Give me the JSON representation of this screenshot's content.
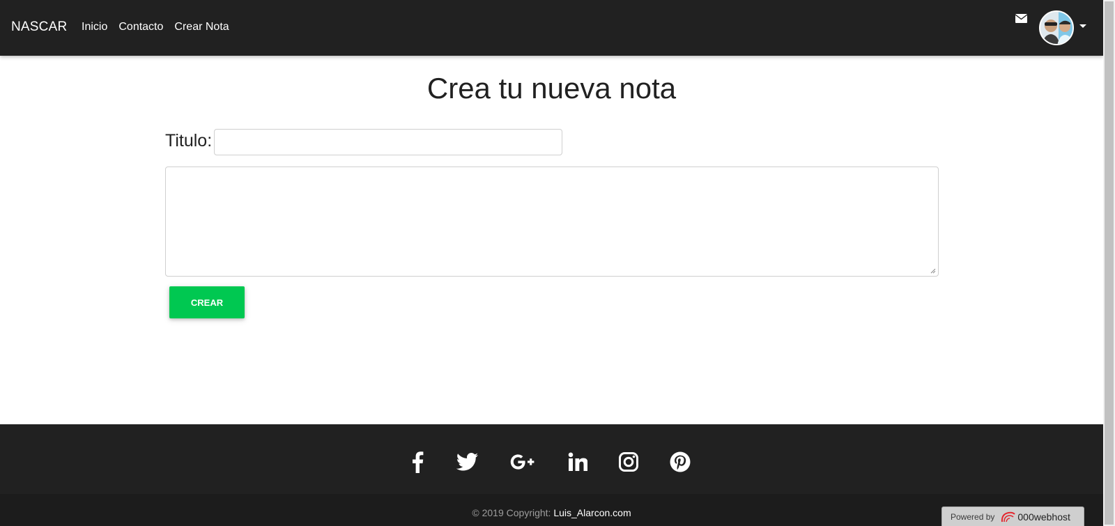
{
  "navbar": {
    "brand": "NASCAR",
    "links": [
      {
        "label": "Inicio"
      },
      {
        "label": "Contacto"
      },
      {
        "label": "Crear Nota"
      }
    ],
    "mail_icon": "envelope-icon",
    "avatar_icon": "user-avatar",
    "dropdown_icon": "caret-down-icon"
  },
  "main": {
    "title": "Crea tu nueva nota",
    "titulo_label": "Titulo:",
    "titulo_value": "",
    "body_value": "",
    "submit_label": "CREAR",
    "submit_color": "#00c851"
  },
  "footer": {
    "social_icons": [
      "facebook-icon",
      "twitter-icon",
      "google-plus-icon",
      "linkedin-icon",
      "instagram-icon",
      "pinterest-icon"
    ],
    "copyright_prefix": "© 2019 Copyright: ",
    "copyright_link": "Luis_Alarcon.com",
    "powered_by": "Powered by",
    "host_name": "000webhost"
  },
  "colors": {
    "navbar_bg": "#212121",
    "footer_bg": "#212121",
    "copyright_bg": "#1c1c1c"
  }
}
